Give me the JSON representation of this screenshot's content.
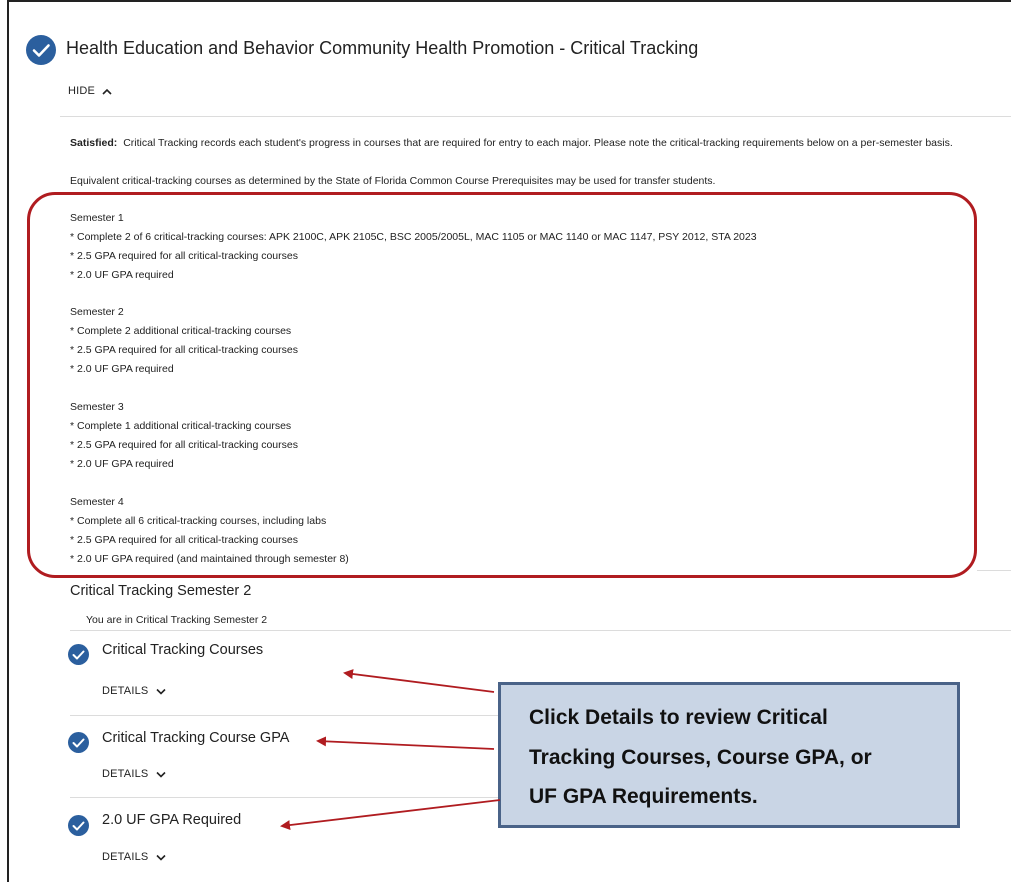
{
  "header": {
    "title": "Health Education and Behavior Community Health Promotion - Critical Tracking",
    "toggle_label": "HIDE"
  },
  "content": {
    "satisfied_label": "Satisfied:",
    "satisfied_text": "Critical Tracking records each student's progress in courses that are required for entry to each major. Please note the critical-tracking requirements below on a per-semester basis.",
    "equivalent_text": "Equivalent critical-tracking courses as determined by the State of Florida Common Course Prerequisites may be used for transfer students.",
    "semesters": [
      {
        "title": "Semester 1",
        "lines": [
          "* Complete 2 of 6 critical-tracking courses: APK 2100C, APK 2105C, BSC 2005/2005L, MAC 1105 or MAC 1140 or MAC 1147, PSY 2012, STA 2023",
          "* 2.5 GPA required for all critical-tracking courses",
          "* 2.0 UF GPA required"
        ]
      },
      {
        "title": "Semester 2",
        "lines": [
          "* Complete 2 additional critical-tracking courses",
          "* 2.5 GPA required for all critical-tracking courses",
          "* 2.0 UF GPA required"
        ]
      },
      {
        "title": "Semester 3",
        "lines": [
          "* Complete 1 additional critical-tracking courses",
          "* 2.5 GPA required for all critical-tracking courses",
          "* 2.0 UF GPA required"
        ]
      },
      {
        "title": "Semester 4",
        "lines": [
          "* Complete all 6 critical-tracking courses, including labs",
          "* 2.5 GPA required for all critical-tracking courses",
          "* 2.0 UF GPA required (and maintained through semester 8)"
        ]
      }
    ]
  },
  "tracking_section": {
    "title": "Critical Tracking Semester 2",
    "subtitle": "You are in Critical Tracking Semester 2"
  },
  "requirements": [
    {
      "title": "Critical Tracking Courses",
      "toggle_label": "DETAILS"
    },
    {
      "title": "Critical Tracking Course GPA",
      "toggle_label": "DETAILS"
    },
    {
      "title": "2.0 UF GPA Required",
      "toggle_label": "DETAILS"
    }
  ],
  "callout": {
    "lines": [
      "Click Details to review Critical",
      "Tracking Courses, Course GPA, or",
      "UF GPA Requirements."
    ]
  },
  "colors": {
    "check": "#2b5f9e",
    "highlight_border": "#b01c20",
    "callout_fill": "#c9d5e5",
    "callout_border": "#4a6388",
    "arrow": "#b01c20"
  }
}
